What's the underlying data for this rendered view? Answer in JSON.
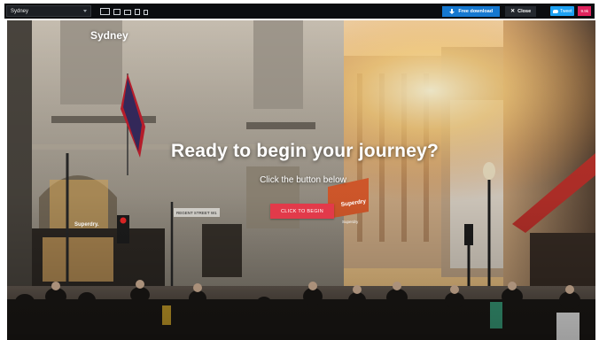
{
  "toolbar": {
    "template_select": {
      "value": "Sydney"
    },
    "device_icons": [
      "desktop-icon",
      "laptop-icon",
      "tablet-landscape-icon",
      "tablet-portrait-icon",
      "mobile-icon"
    ],
    "download_label": "Free download",
    "close_label": "Close",
    "tweet_label": "Tweet",
    "tweet_badge": "9.9k",
    "colors": {
      "bar": "#0b0d10",
      "download": "#1578d0",
      "tweet": "#1da1f2"
    }
  },
  "hero": {
    "brand": "Sydney",
    "headline": "Ready to begin your journey?",
    "subheadline": "Click the button below",
    "cta_label": "CLICK TO BEGIN",
    "cta_color": "#e23a4a",
    "street_sign": "REGENT STREET W1",
    "shop_sign_1": "Superdry",
    "shop_sign_2": "Superdry.",
    "shop_sign_3": "Superdry"
  }
}
